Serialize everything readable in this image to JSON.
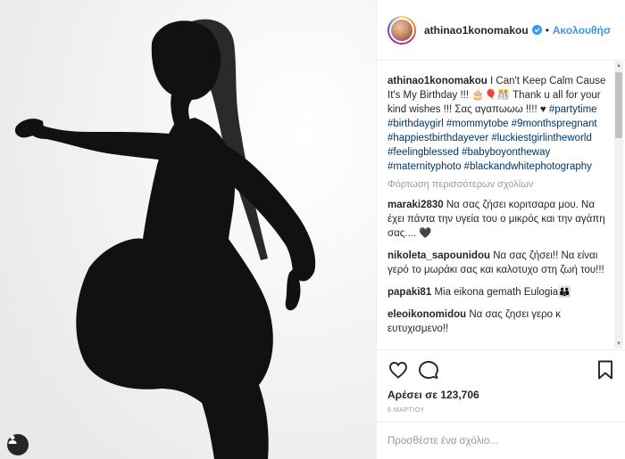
{
  "photo": {
    "description_icon": "user-tag-icon"
  },
  "header": {
    "username": "athinao1konomakou",
    "separator": "•",
    "follow_label": "Ακολουθήσ"
  },
  "caption": {
    "username": "athinao1konomakou",
    "text": "I Can't Keep Calm Cause It's My Birthday !!! 🎂🎈🎊 Thank u all for your kind wishes !!! Σας αγαπωωω !!!! ♥",
    "hashtags": [
      "#partytime",
      "#birthdaygirl",
      "#mommytobe",
      "#9monthspregnant",
      "#happiestbirthdayever",
      "#luckiestgirlintheworld",
      "#feelingblessed",
      "#babyboyontheway",
      "#maternityphoto",
      "#blackandwhitephotography"
    ]
  },
  "load_more_label": "Φόρτωση περισσότερων σχολίων",
  "comments": [
    {
      "username": "maraki2830",
      "text": "Να σας ζήσει κοριτσαρα μου. Να έχει πάντα την υγεία του ο μικρός και την αγάπη σας.... 🖤"
    },
    {
      "username": "nikoleta_sapounidou",
      "text": "Να σας ζήσει!! Να είναι γερό το μωράκι σας και καλοτυχο στη ζωή του!!!"
    },
    {
      "username": "papaki81",
      "text": "Mia eikona gemath Eulogia👪"
    },
    {
      "username": "eleoikonomidou",
      "text": "Να σας ζησει γερο κ ευτυχισμενο!!"
    }
  ],
  "likes_label": "Αρέσει σε 123,706",
  "date_label": "6 ΜΑΡΤΙΟΥ",
  "add_comment_placeholder": "Προσθέστε ένα σχόλιο...",
  "colors": {
    "accent": "#3897f0",
    "hashtag": "#003569",
    "text": "#262626",
    "muted": "#999999"
  }
}
